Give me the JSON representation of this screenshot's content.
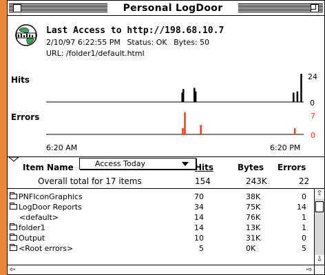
{
  "window": {
    "title": "Personal LogDoor"
  },
  "header": {
    "last_access": "Last Access to  http://198.68.10.7",
    "datetime": "2/10/97 6:22:55 PM",
    "status": "Status: OK",
    "bytes": "Bytes: 50",
    "url": "URL: /folder1/default.html"
  },
  "chart_data": [
    {
      "type": "bar",
      "title": "Hits",
      "ylim": [
        0,
        24
      ],
      "y_ticks": [
        "24",
        "0"
      ],
      "color": "#000000",
      "bars": [
        {
          "x": 0.528,
          "value": 8
        },
        {
          "x": 0.532,
          "value": 11
        },
        {
          "x": 0.575,
          "value": 12
        },
        {
          "x": 0.58,
          "value": 9
        },
        {
          "x": 0.96,
          "value": 8
        },
        {
          "x": 0.975,
          "value": 9
        },
        {
          "x": 0.99,
          "value": 24
        }
      ]
    },
    {
      "type": "bar",
      "title": "Errors",
      "ylim": [
        0,
        7
      ],
      "y_ticks": [
        "7",
        "0"
      ],
      "color": "#ff3b0f",
      "bars": [
        {
          "x": 0.53,
          "value": 2
        },
        {
          "x": 0.538,
          "value": 7
        },
        {
          "x": 0.6,
          "value": 3
        },
        {
          "x": 0.965,
          "value": 2
        }
      ],
      "x_ticks": [
        "6:20 AM",
        "6:20 PM"
      ]
    }
  ],
  "list": {
    "filter_label": "Access Today",
    "columns": {
      "name": "Item Name",
      "hits": "Hits",
      "bytes": "Bytes",
      "errors": "Errors"
    },
    "total": {
      "name": "Overall total for 17 items",
      "hits": "154",
      "bytes": "243K",
      "errors": "22"
    },
    "rows": [
      {
        "name": "PNFIconGraphics",
        "folder": true,
        "hits": "70",
        "bytes": "38K",
        "errors": "0"
      },
      {
        "name": "LogDoor Reports",
        "folder": true,
        "hits": "34",
        "bytes": "75K",
        "errors": "14"
      },
      {
        "name": "<default>",
        "folder": false,
        "hits": "14",
        "bytes": "76K",
        "errors": "1"
      },
      {
        "name": "folder1",
        "folder": true,
        "hits": "14",
        "bytes": "13K",
        "errors": "1"
      },
      {
        "name": "Output",
        "folder": true,
        "hits": "10",
        "bytes": "31K",
        "errors": "0"
      },
      {
        "name": "<Root errors>",
        "folder": true,
        "hits": "5",
        "bytes": "0K",
        "errors": "5"
      }
    ]
  }
}
